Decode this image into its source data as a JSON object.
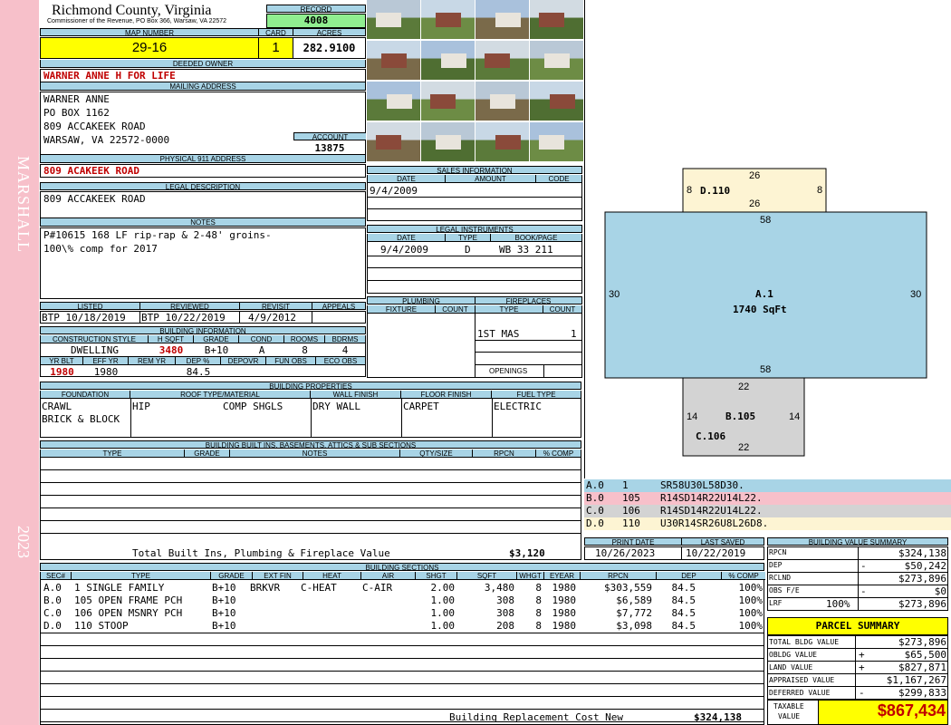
{
  "sidebar": {
    "name": "MARSHALL",
    "year": "2023",
    "bg": "#f7c0ca"
  },
  "county": {
    "title": "Richmond County, Virginia",
    "address": "Commissioner of the Revenue, PO Box 366, Warsaw, VA 22572"
  },
  "record": {
    "label": "RECORD",
    "value": "4008"
  },
  "map": {
    "label": "MAP NUMBER",
    "value": "29-16"
  },
  "card": {
    "label": "CARD",
    "value": "1"
  },
  "acres": {
    "label": "ACRES",
    "value": "282.9100"
  },
  "owner": {
    "label": "DEEDED OWNER",
    "value": "WARNER ANNE H FOR LIFE"
  },
  "mailing": {
    "label": "MAILING ADDRESS",
    "line1": "WARNER ANNE",
    "line2": "PO BOX 1162",
    "line3": "809 ACCAKEEK ROAD",
    "line4": "WARSAW, VA 22572-0000"
  },
  "account": {
    "label": "ACCOUNT",
    "value": "13875"
  },
  "physical": {
    "label": "PHYSICAL 911 ADDRESS",
    "value": "809 ACAKEEK ROAD"
  },
  "legal": {
    "label": "LEGAL DESCRIPTION",
    "value": "809 ACCAKEEK ROAD"
  },
  "notes": {
    "label": "NOTES",
    "line1": "P#10615 168 LF rip-rap & 2-48' groins-",
    "line2": "100\\% comp for 2017"
  },
  "listed": {
    "listed_label": "LISTED",
    "reviewed_label": "REVIEWED",
    "revisit_label": "REVISIT",
    "appeals_label": "APPEALS",
    "listed": "BTP 10/18/2019",
    "reviewed": "BTP 10/22/2019",
    "revisit": "4/9/2012",
    "appeals": ""
  },
  "building_info": {
    "label": "BUILDING INFORMATION",
    "h_construction": "CONSTRUCTION STYLE",
    "h_hsqft": "H SQFT",
    "h_grade": "GRADE",
    "h_cond": "COND",
    "h_rooms": "ROOMS",
    "h_bdrms": "BDRMS",
    "construction": "DWELLING",
    "hsqft": "3480",
    "grade": "B+10",
    "cond": "A",
    "rooms": "8",
    "bdrms": "4",
    "h_yrblt": "YR BLT",
    "h_effyr": "EFF YR",
    "h_remyr": "REM YR",
    "h_dep": "DEP %",
    "h_depovr": "DEPOVR",
    "h_funobs": "FUN OBS",
    "h_ecoobs": "ECO OBS",
    "yrblt": "1980",
    "effyr": "1980",
    "dep": "84.5"
  },
  "sales": {
    "label": "SALES INFORMATION",
    "h_date": "DATE",
    "h_amount": "AMOUNT",
    "h_code": "CODE",
    "date": "9/4/2009"
  },
  "legal_instr": {
    "label": "LEGAL INSTRUMENTS",
    "h_date": "DATE",
    "h_type": "TYPE",
    "h_book": "BOOK/PAGE",
    "date": "9/4/2009",
    "type": "D",
    "book": "WB 33 211"
  },
  "plumbing": {
    "label": "PLUMBING",
    "h_fixture": "FIXTURE",
    "h_count": "COUNT"
  },
  "fireplaces": {
    "label": "FIREPLACES",
    "h_type": "TYPE",
    "h_count": "COUNT",
    "type": "1ST MAS",
    "count": "1",
    "openings": "OPENINGS"
  },
  "properties": {
    "label": "BUILDING PROPERTIES",
    "h_foundation": "FOUNDATION",
    "h_roof": "ROOF TYPE/MATERIAL",
    "h_wall": "WALL FINISH",
    "h_floor": "FLOOR FINISH",
    "h_fuel": "FUEL TYPE",
    "foundation1": "CRAWL",
    "foundation2": "BRICK & BLOCK",
    "roof_type": "HIP",
    "roof_mat": "COMP SHGLS",
    "wall": "DRY WALL",
    "floor": "CARPET",
    "fuel": "ELECTRIC"
  },
  "builtins": {
    "label": "BUILDING BUILT INS, BASEMENTS, ATTICS & SUB SECTIONS",
    "h_type": "TYPE",
    "h_grade": "GRADE",
    "h_notes": "NOTES",
    "h_qty": "QTY/SIZE",
    "h_rpcn": "RPCN",
    "h_comp": "% COMP",
    "total_label": "Total Built Ins, Plumbing & Fireplace Value",
    "total_value": "$3,120"
  },
  "print": {
    "print_label": "PRINT DATE",
    "saved_label": "LAST SAVED",
    "print_date": "10/26/2023",
    "saved_date": "10/22/2019"
  },
  "sections": {
    "label": "BUILDING SECTIONS",
    "headers": [
      "SEC#",
      "TYPE",
      "GRADE",
      "EXT FIN",
      "HEAT",
      "AIR",
      "SHGT",
      "SQFT",
      "WHGT",
      "EYEAR",
      "RPCN",
      "DEP",
      "% COMP"
    ],
    "rows": [
      {
        "sec": "A.0",
        "type": "1 SINGLE FAMILY",
        "grade": "B+10",
        "ext": "BRKVR",
        "heat": "C-HEAT",
        "air": "C-AIR",
        "shgt": "2.00",
        "sqft": "3,480",
        "whgt": "8",
        "eyear": "1980",
        "rpcn": "$303,559",
        "dep": "84.5",
        "comp": "100%"
      },
      {
        "sec": "B.0",
        "type": "105 OPEN FRAME PCH",
        "grade": "B+10",
        "ext": "",
        "heat": "",
        "air": "",
        "shgt": "1.00",
        "sqft": "308",
        "whgt": "8",
        "eyear": "1980",
        "rpcn": "$6,589",
        "dep": "84.5",
        "comp": "100%"
      },
      {
        "sec": "C.0",
        "type": "106 OPEN MSNRY PCH",
        "grade": "B+10",
        "ext": "",
        "heat": "",
        "air": "",
        "shgt": "1.00",
        "sqft": "308",
        "whgt": "8",
        "eyear": "1980",
        "rpcn": "$7,772",
        "dep": "84.5",
        "comp": "100%"
      },
      {
        "sec": "D.0",
        "type": "110 STOOP",
        "grade": "B+10",
        "ext": "",
        "heat": "",
        "air": "",
        "shgt": "1.00",
        "sqft": "208",
        "whgt": "8",
        "eyear": "1980",
        "rpcn": "$3,098",
        "dep": "84.5",
        "comp": "100%"
      }
    ],
    "brcn_label": "Building Replacement Cost New",
    "brcn_value": "$324,138"
  },
  "sketch": {
    "d_label": "D.110",
    "d_top": "26",
    "d_bottom": "26",
    "d_left": "8",
    "d_right": "8",
    "a_label": "A.1",
    "a_sqft": "1740 SqFt",
    "a_top": "58",
    "a_bottom": "58",
    "a_left": "30",
    "a_right": "30",
    "b_label": "B.105",
    "b_top": "22",
    "b_left": "14",
    "b_right": "14",
    "c_label": "C.106",
    "c_bottom": "22"
  },
  "legend": [
    {
      "sec": "A.0",
      "code": "1",
      "vec": "SR58U30L58D30.",
      "color": "#a8d4e6"
    },
    {
      "sec": "B.0",
      "code": "105",
      "vec": "R14SD14R22U14L22.",
      "color": "#f7c0ca"
    },
    {
      "sec": "C.0",
      "code": "106",
      "vec": "R14SD14R22U14L22.",
      "color": "#d3d3d3"
    },
    {
      "sec": "D.0",
      "code": "110",
      "vec": "U30R14SR26U8L26D8.",
      "color": "#fdf4d3"
    }
  ],
  "value_summary": {
    "label": "BUILDING VALUE SUMMARY",
    "rpcn_label": "RPCN",
    "rpcn": "$324,138",
    "dep_label": "DEP",
    "dep_sign": "-",
    "dep": "$50,242",
    "rclnd_label": "RCLND",
    "rclnd": "$273,896",
    "obs_label": "OBS F/E",
    "obs_sign": "-",
    "obs": "$0",
    "lrf_label": "LRF",
    "lrf_pct": "100%",
    "lrf": "$273,896"
  },
  "parcel": {
    "title": "PARCEL SUMMARY",
    "bldg_label": "TOTAL BLDG VALUE",
    "bldg": "$273,896",
    "obldg_label": "OBLDG VALUE",
    "obldg_sign": "+",
    "obldg": "$65,500",
    "land_label": "LAND VALUE",
    "land_sign": "+",
    "land": "$827,871",
    "appr_label": "APPRAISED VALUE",
    "appr": "$1,167,267",
    "def_label": "DEFERRED VALUE",
    "def_sign": "-",
    "def": "$299,833",
    "tax_label1": "TAXABLE",
    "tax_label2": "VALUE",
    "tax": "$867,434"
  },
  "colors": {
    "header": "#a8d4e6",
    "yellow": "#ffff00",
    "green": "#90ee90",
    "red": "#c00000",
    "sketch_a": "#a8d4e6",
    "sketch_b": "#d3d3d3",
    "sketch_d": "#fdf4d3"
  }
}
